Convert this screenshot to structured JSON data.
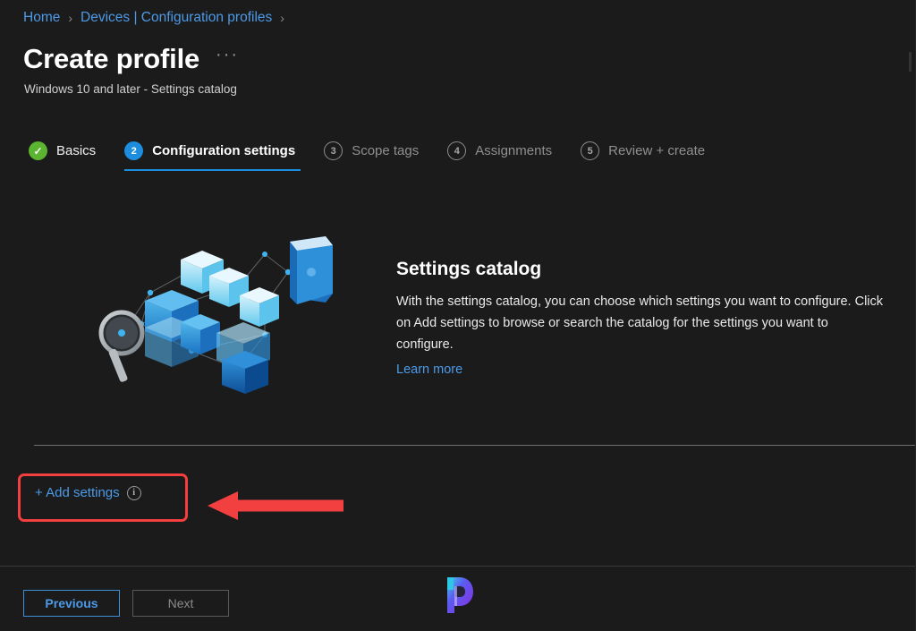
{
  "breadcrumb": {
    "items": [
      {
        "label": "Home"
      },
      {
        "label": "Devices | Configuration profiles"
      }
    ],
    "separator": "›"
  },
  "header": {
    "title": "Create profile",
    "more_menu": "···",
    "subtitle": "Windows 10 and later - Settings catalog"
  },
  "wizard": {
    "steps": [
      {
        "number": "1",
        "badge": "✓",
        "label": "Basics",
        "state": "done"
      },
      {
        "number": "2",
        "badge": "2",
        "label": "Configuration settings",
        "state": "active"
      },
      {
        "number": "3",
        "badge": "3",
        "label": "Scope tags",
        "state": "todo"
      },
      {
        "number": "4",
        "badge": "4",
        "label": "Assignments",
        "state": "todo"
      },
      {
        "number": "5",
        "badge": "5",
        "label": "Review + create",
        "state": "todo"
      }
    ]
  },
  "hero": {
    "title": "Settings catalog",
    "body": "With the settings catalog, you can choose which settings you want to configure. Click on Add settings to browse or search the catalog for the settings you want to configure.",
    "learn_more": "Learn more"
  },
  "actions": {
    "add_settings_label": "+ Add settings",
    "info_icon": "info-icon"
  },
  "footer": {
    "previous_label": "Previous",
    "next_label": "Next",
    "logo": "prajwal-desai-logo"
  },
  "colors": {
    "background": "#1b1b1b",
    "link_blue": "#4c9ae8",
    "active_step_blue": "#1c8ddf",
    "done_step_green": "#5cb530",
    "annotation_red": "#f1403f",
    "divider_gray": "#8b8b87"
  }
}
